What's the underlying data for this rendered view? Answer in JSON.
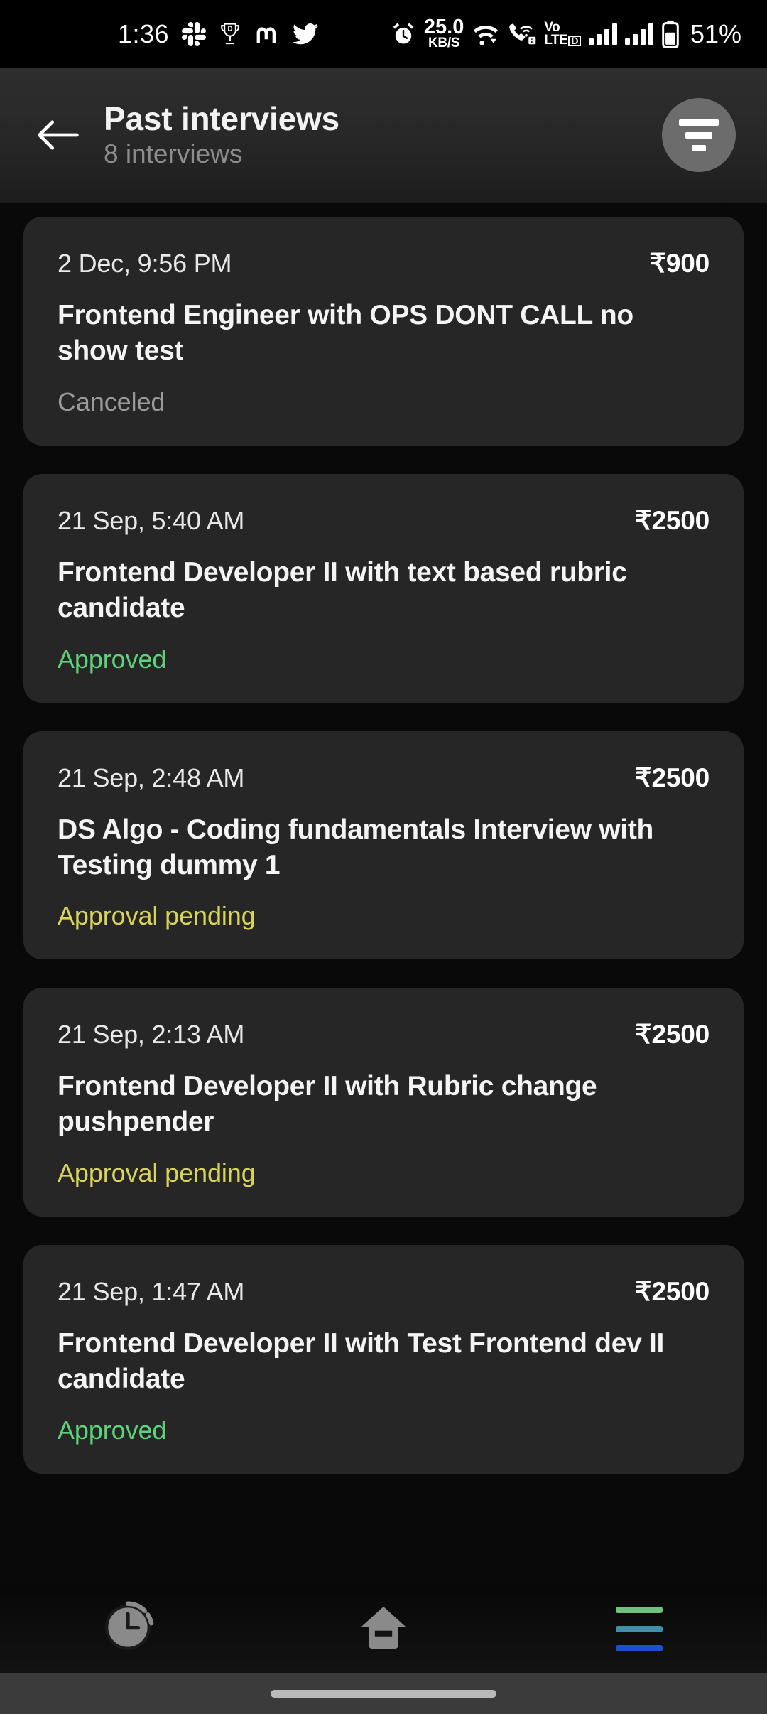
{
  "status_bar": {
    "time": "1:36",
    "app_icons": [
      "slack-icon",
      "trophy-d-icon",
      "mastodon-icon",
      "twitter-icon"
    ],
    "alarm_icon": "alarm-clock-icon",
    "net_speed_value": "25.0",
    "net_speed_unit": "KB/S",
    "wifi_icon": "wifi-icon",
    "wifi_calling_icon": "wifi-calling-icon",
    "wifi_calling_sim": "2",
    "volte_line1": "Vo",
    "volte_line2": "LTE",
    "volte_sim": "D",
    "signal_icons": [
      "signal-bars-sim1",
      "signal-bars-sim2"
    ],
    "battery_icon": "battery-icon",
    "battery_percent": "51%"
  },
  "header": {
    "back_icon": "back-arrow-icon",
    "title": "Past interviews",
    "subtitle": "8 interviews",
    "filter_icon": "filter-icon"
  },
  "interviews": [
    {
      "date": "2 Dec, 9:56 PM",
      "price": "₹900",
      "title": "Frontend Engineer  with OPS DONT CALL no show test",
      "status": "Canceled",
      "status_style": "st-canceled"
    },
    {
      "date": "21 Sep, 5:40 AM",
      "price": "₹2500",
      "title": "Frontend Developer II  with text based rubric candidate",
      "status": "Approved",
      "status_style": "st-approved"
    },
    {
      "date": "21 Sep, 2:48 AM",
      "price": "₹2500",
      "title": "DS Algo - Coding fundamentals Interview  with Testing dummy 1",
      "status": "Approval pending",
      "status_style": "st-pending"
    },
    {
      "date": "21 Sep, 2:13 AM",
      "price": "₹2500",
      "title": "Frontend Developer II  with Rubric change pushpender",
      "status": "Approval pending",
      "status_style": "st-pending"
    },
    {
      "date": "21 Sep, 1:47 AM",
      "price": "₹2500",
      "title": "Frontend Developer II with Test Frontend dev II candidate",
      "status": "Approved",
      "status_style": "st-approved"
    }
  ],
  "bottom_nav": {
    "items": [
      {
        "icon": "recent-apps-clock-icon"
      },
      {
        "icon": "home-icon"
      },
      {
        "icon": "menu-icon"
      }
    ],
    "menu_line_colors": [
      "#6ec27e",
      "#3f90a8",
      "#1a4fd0"
    ]
  },
  "colors": {
    "page_background": "#090909",
    "card_background": "#262626",
    "header_background": "#2b2b2b",
    "status_approved": "#5ed27a",
    "status_pending": "#d8d45a",
    "status_canceled": "#9a9a9a",
    "filter_button": "#6c6c6c"
  }
}
